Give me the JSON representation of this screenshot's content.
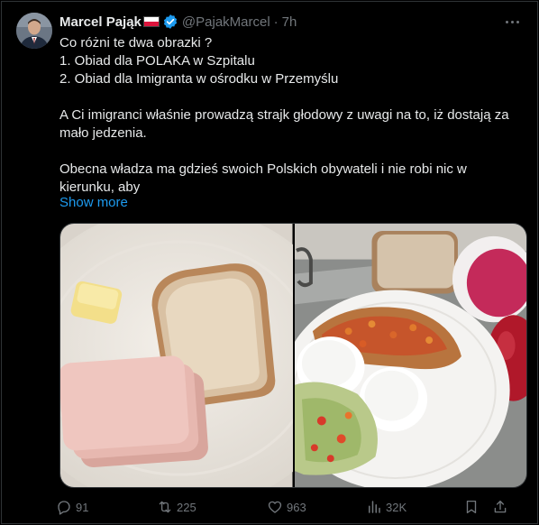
{
  "author": {
    "name": "Marcel Pająk",
    "handle": "@PajakMarcel",
    "time": "7h",
    "avatar_icon": "avatar-photo",
    "flag_icon": "poland-flag-icon",
    "verified_icon": "verified-badge-icon"
  },
  "tweet": {
    "lines": [
      "Co różni te dwa obrazki ?",
      "1. Obiad dla POLAKA w Szpitalu",
      "2. Obiad dla Imigranta w ośrodku w Przemyślu",
      "",
      "A Ci imigranci  właśnie prowadzą strajk głodowy z uwagi na to, iż dostają za",
      "mało jedzenia.",
      "",
      "Obecna władza ma gdzieś swoich Polskich obywateli i nie robi nic w",
      "kierunku, aby"
    ],
    "show_more": "Show more"
  },
  "media": [
    {
      "name": "hospital-meal-photo"
    },
    {
      "name": "immigrant-meal-photo"
    }
  ],
  "actions": {
    "replies": "91",
    "reposts": "225",
    "likes": "963",
    "views": "32K"
  },
  "colors": {
    "background": "#000000",
    "text": "#e7e9ea",
    "muted": "#71767b",
    "link": "#1d9bf0",
    "border": "#2f3336"
  }
}
